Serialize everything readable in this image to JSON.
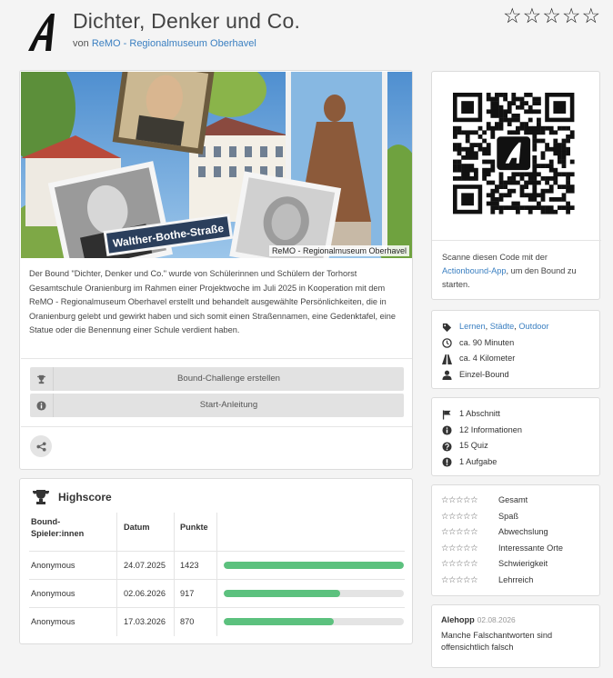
{
  "header": {
    "title": "Dichter, Denker und Co.",
    "by_prefix": "von",
    "author": "ReMO - Regionalmuseum Oberhavel",
    "stars": [
      "☆",
      "☆",
      "☆",
      "☆",
      "☆"
    ]
  },
  "hero": {
    "credit": "ReMO - Regionalmuseum Oberhavel",
    "street_sign": "Walther-Bothe-Straße"
  },
  "description": "Der Bound \"Dichter, Denker und Co.\" wurde von Schülerinnen und Schülern der Torhorst Gesamtschule Oranienburg im Rahmen einer Projektwoche im Juli 2025 in Kooperation mit dem ReMO - Regionalmuseum Oberhavel erstellt und behandelt ausgewählte Persönlichkeiten, die in Oranienburg gelebt und gewirkt haben und sich somit einen Straßennamen, eine Gedenktafel, eine Statue oder die Benennung einer Schule verdient haben.",
  "actions": {
    "challenge_label": "Bound-Challenge erstellen",
    "guide_label": "Start-Anleitung"
  },
  "highscore": {
    "title": "Highscore",
    "headers": [
      "Bound-Spieler:innen",
      "Datum",
      "Punkte"
    ],
    "rows": [
      {
        "player": "Anonymous",
        "date": "24.07.2025",
        "points": "1423",
        "fraction": 1.0
      },
      {
        "player": "Anonymous",
        "date": "02.06.2026",
        "points": "917",
        "fraction": 0.644
      },
      {
        "player": "Anonymous",
        "date": "17.03.2026",
        "points": "870",
        "fraction": 0.611
      }
    ]
  },
  "qr": {
    "text_before": "Scanne diesen Code mit der",
    "link": "Actionbound-App",
    "text_after": ", um den Bound zu starten."
  },
  "info": {
    "categories": [
      "Lernen",
      "Städte",
      "Outdoor"
    ],
    "duration": "ca. 90 Minuten",
    "distance": "ca. 4 Kilometer",
    "mode": "Einzel-Bound"
  },
  "stats": {
    "sections": "1 Abschnitt",
    "informations": "12 Informationen",
    "quiz": "15 Quiz",
    "tasks": "1 Aufgabe"
  },
  "ratings": {
    "star_glyphs": "☆☆☆☆☆",
    "items": [
      "Gesamt",
      "Spaß",
      "Abwechslung",
      "Interessante Orte",
      "Schwierigkeit",
      "Lehrreich"
    ]
  },
  "review": {
    "user": "Alehopp",
    "date": "02.08.2026",
    "text": "Manche Falschantworten sind offensichtlich falsch"
  },
  "colors": {
    "link": "#3a7fc1",
    "bar": "#5cc17e",
    "button": "#e2e2e2"
  }
}
